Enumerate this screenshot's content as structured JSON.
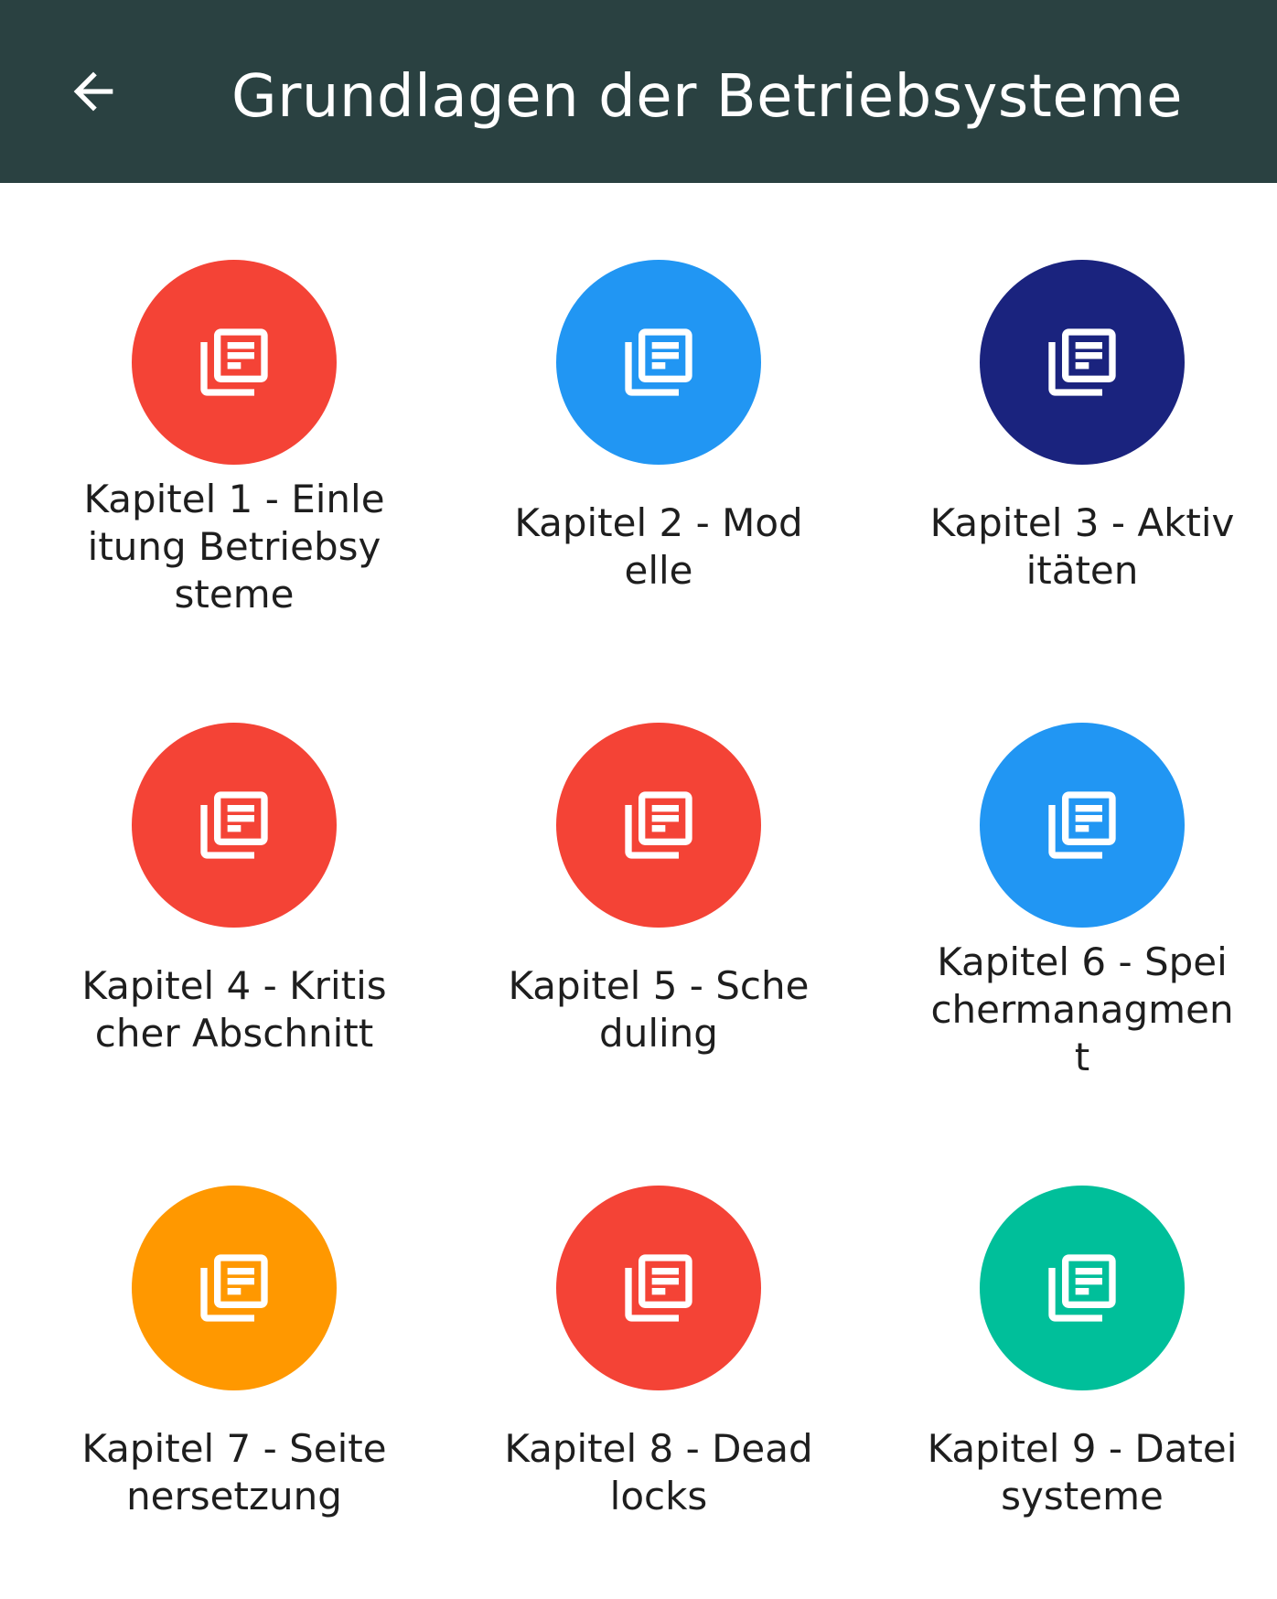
{
  "header": {
    "title": "Grundlagen der Betriebsysteme",
    "back_icon": "arrow-left-icon",
    "background": "#2a4141"
  },
  "chapters": [
    {
      "label": "Kapitel 1 - Einleitung Betriebsysteme",
      "color": "#f44336",
      "icon": "library-books-icon"
    },
    {
      "label": "Kapitel 2 - Modelle",
      "color": "#2196f3",
      "icon": "library-books-icon"
    },
    {
      "label": "Kapitel 3 - Aktivitäten",
      "color": "#1a237e",
      "icon": "library-books-icon"
    },
    {
      "label": "Kapitel 4 - Kritischer Abschnitt",
      "color": "#f44336",
      "icon": "library-books-icon"
    },
    {
      "label": "Kapitel 5 - Scheduling",
      "color": "#f44336",
      "icon": "library-books-icon"
    },
    {
      "label": "Kapitel 6 - Speichermanagment",
      "color": "#2196f3",
      "icon": "library-books-icon"
    },
    {
      "label": "Kapitel 7 - Seitenersetzung",
      "color": "#ff9800",
      "icon": "library-books-icon"
    },
    {
      "label": "Kapitel 8 - Deadlocks",
      "color": "#f44336",
      "icon": "library-books-icon"
    },
    {
      "label": "Kapitel 9 - Dateisysteme",
      "color": "#00bf9a",
      "icon": "library-books-icon"
    }
  ]
}
